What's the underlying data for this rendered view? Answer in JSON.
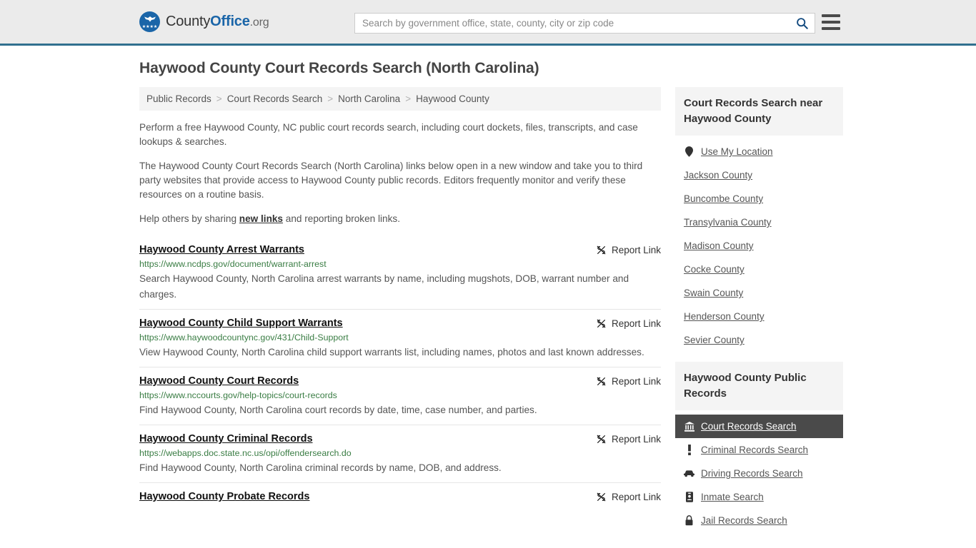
{
  "header": {
    "brand": {
      "part1": "County",
      "part2": "Office",
      "part3": ".org",
      "seal_icon": "eagle-seal-icon"
    },
    "search": {
      "placeholder": "Search by government office, state, county, city or zip code",
      "value": "",
      "search_icon": "search-icon"
    },
    "menu_icon": "hamburger-menu-icon",
    "accent_color": "#31708f",
    "background_color": "#ebebeb"
  },
  "page_title": "Haywood County Court Records Search (North Carolina)",
  "breadcrumb": {
    "separator": ">",
    "items": [
      {
        "label": "Public Records"
      },
      {
        "label": "Court Records Search"
      },
      {
        "label": "North Carolina"
      },
      {
        "label": "Haywood County"
      }
    ]
  },
  "intro": {
    "p1": "Perform a free Haywood County, NC public court records search, including court dockets, files, transcripts, and case lookups & searches.",
    "p2": "The Haywood County Court Records Search (North Carolina) links below open in a new window and take you to third party websites that provide access to Haywood County public records. Editors frequently monitor and verify these resources on a routine basis.",
    "p3_before": "Help others by sharing ",
    "p3_link": "new links",
    "p3_after": " and reporting broken links."
  },
  "report_link_label": "Report Link",
  "report_link_icon": "broken-link-icon",
  "results": [
    {
      "title": "Haywood County Arrest Warrants",
      "url": "https://www.ncdps.gov/document/warrant-arrest",
      "description": "Search Haywood County, North Carolina arrest warrants by name, including mugshots, DOB, warrant number and charges."
    },
    {
      "title": "Haywood County Child Support Warrants",
      "url": "https://www.haywoodcountync.gov/431/Child-Support",
      "description": "View Haywood County, North Carolina child support warrants list, including names, photos and last known addresses."
    },
    {
      "title": "Haywood County Court Records",
      "url": "https://www.nccourts.gov/help-topics/court-records",
      "description": "Find Haywood County, North Carolina court records by date, time, case number, and parties."
    },
    {
      "title": "Haywood County Criminal Records",
      "url": "https://webapps.doc.state.nc.us/opi/offendersearch.do",
      "description": "Find Haywood County, North Carolina criminal records by name, DOB, and address."
    },
    {
      "title": "Haywood County Probate Records",
      "url": "",
      "description": ""
    }
  ],
  "sidebar": {
    "nearby": {
      "heading": "Court Records Search near Haywood County",
      "items": [
        {
          "label": "Use My Location",
          "icon": "location-pin-icon"
        },
        {
          "label": "Jackson County",
          "icon": ""
        },
        {
          "label": "Buncombe County",
          "icon": ""
        },
        {
          "label": "Transylvania County",
          "icon": ""
        },
        {
          "label": "Madison County",
          "icon": ""
        },
        {
          "label": "Cocke County",
          "icon": ""
        },
        {
          "label": "Swain County",
          "icon": ""
        },
        {
          "label": "Henderson County",
          "icon": ""
        },
        {
          "label": "Sevier County",
          "icon": ""
        }
      ]
    },
    "public_records": {
      "heading": "Haywood County Public Records",
      "active_index": 0,
      "items": [
        {
          "label": "Court Records Search",
          "icon": "courthouse-icon"
        },
        {
          "label": "Criminal Records Search",
          "icon": "exclamation-icon"
        },
        {
          "label": "Driving Records Search",
          "icon": "car-icon"
        },
        {
          "label": "Inmate Search",
          "icon": "id-badge-icon"
        },
        {
          "label": "Jail Records Search",
          "icon": "lock-icon"
        }
      ]
    }
  }
}
